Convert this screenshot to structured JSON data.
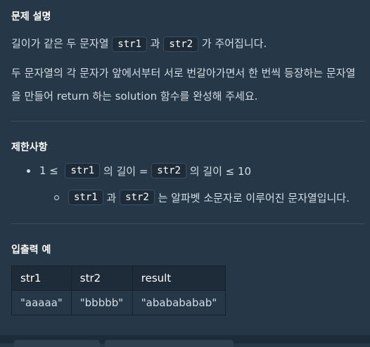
{
  "problem": {
    "heading": "문제 설명",
    "line1": {
      "pre": "길이가 같은 두 문자열",
      "code1": "str1",
      "mid": "과",
      "code2": "str2",
      "post": "가 주어집니다."
    },
    "line2": "두 문자열의 각 문자가 앞에서부터 서로 번갈아가면서 한 번씩 등장하는 문자열을 만들어 return 하는 solution 함수를 완성해 주세요."
  },
  "limits": {
    "heading": "제한사항",
    "item1": {
      "pre": "1 ≤",
      "code1": "str1",
      "mid": "의 길이 =",
      "code2": "str2",
      "post": "의 길이 ≤ 10"
    },
    "item2": {
      "code1": "str1",
      "mid": "과",
      "code2": "str2",
      "post": "는 알파벳 소문자로 이루어진 문자열입니다."
    }
  },
  "examples": {
    "heading": "입출력 예",
    "columns": [
      "str1",
      "str2",
      "result"
    ],
    "rows": [
      [
        "\"aaaaa\"",
        "\"bbbbb\"",
        "\"ababababab\""
      ]
    ]
  }
}
